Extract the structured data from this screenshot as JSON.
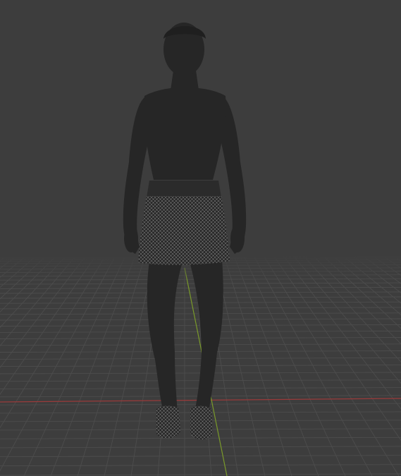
{
  "viewport": {
    "background_color": "#3d3d3d",
    "grid_color": "#4d4d4d",
    "x_axis_color": "#9a3a3a",
    "y_axis_color": "#7a9a2a",
    "model_color": "#262626",
    "wireframe_color": "#8a8a8a",
    "model_icon": "human-figure"
  }
}
